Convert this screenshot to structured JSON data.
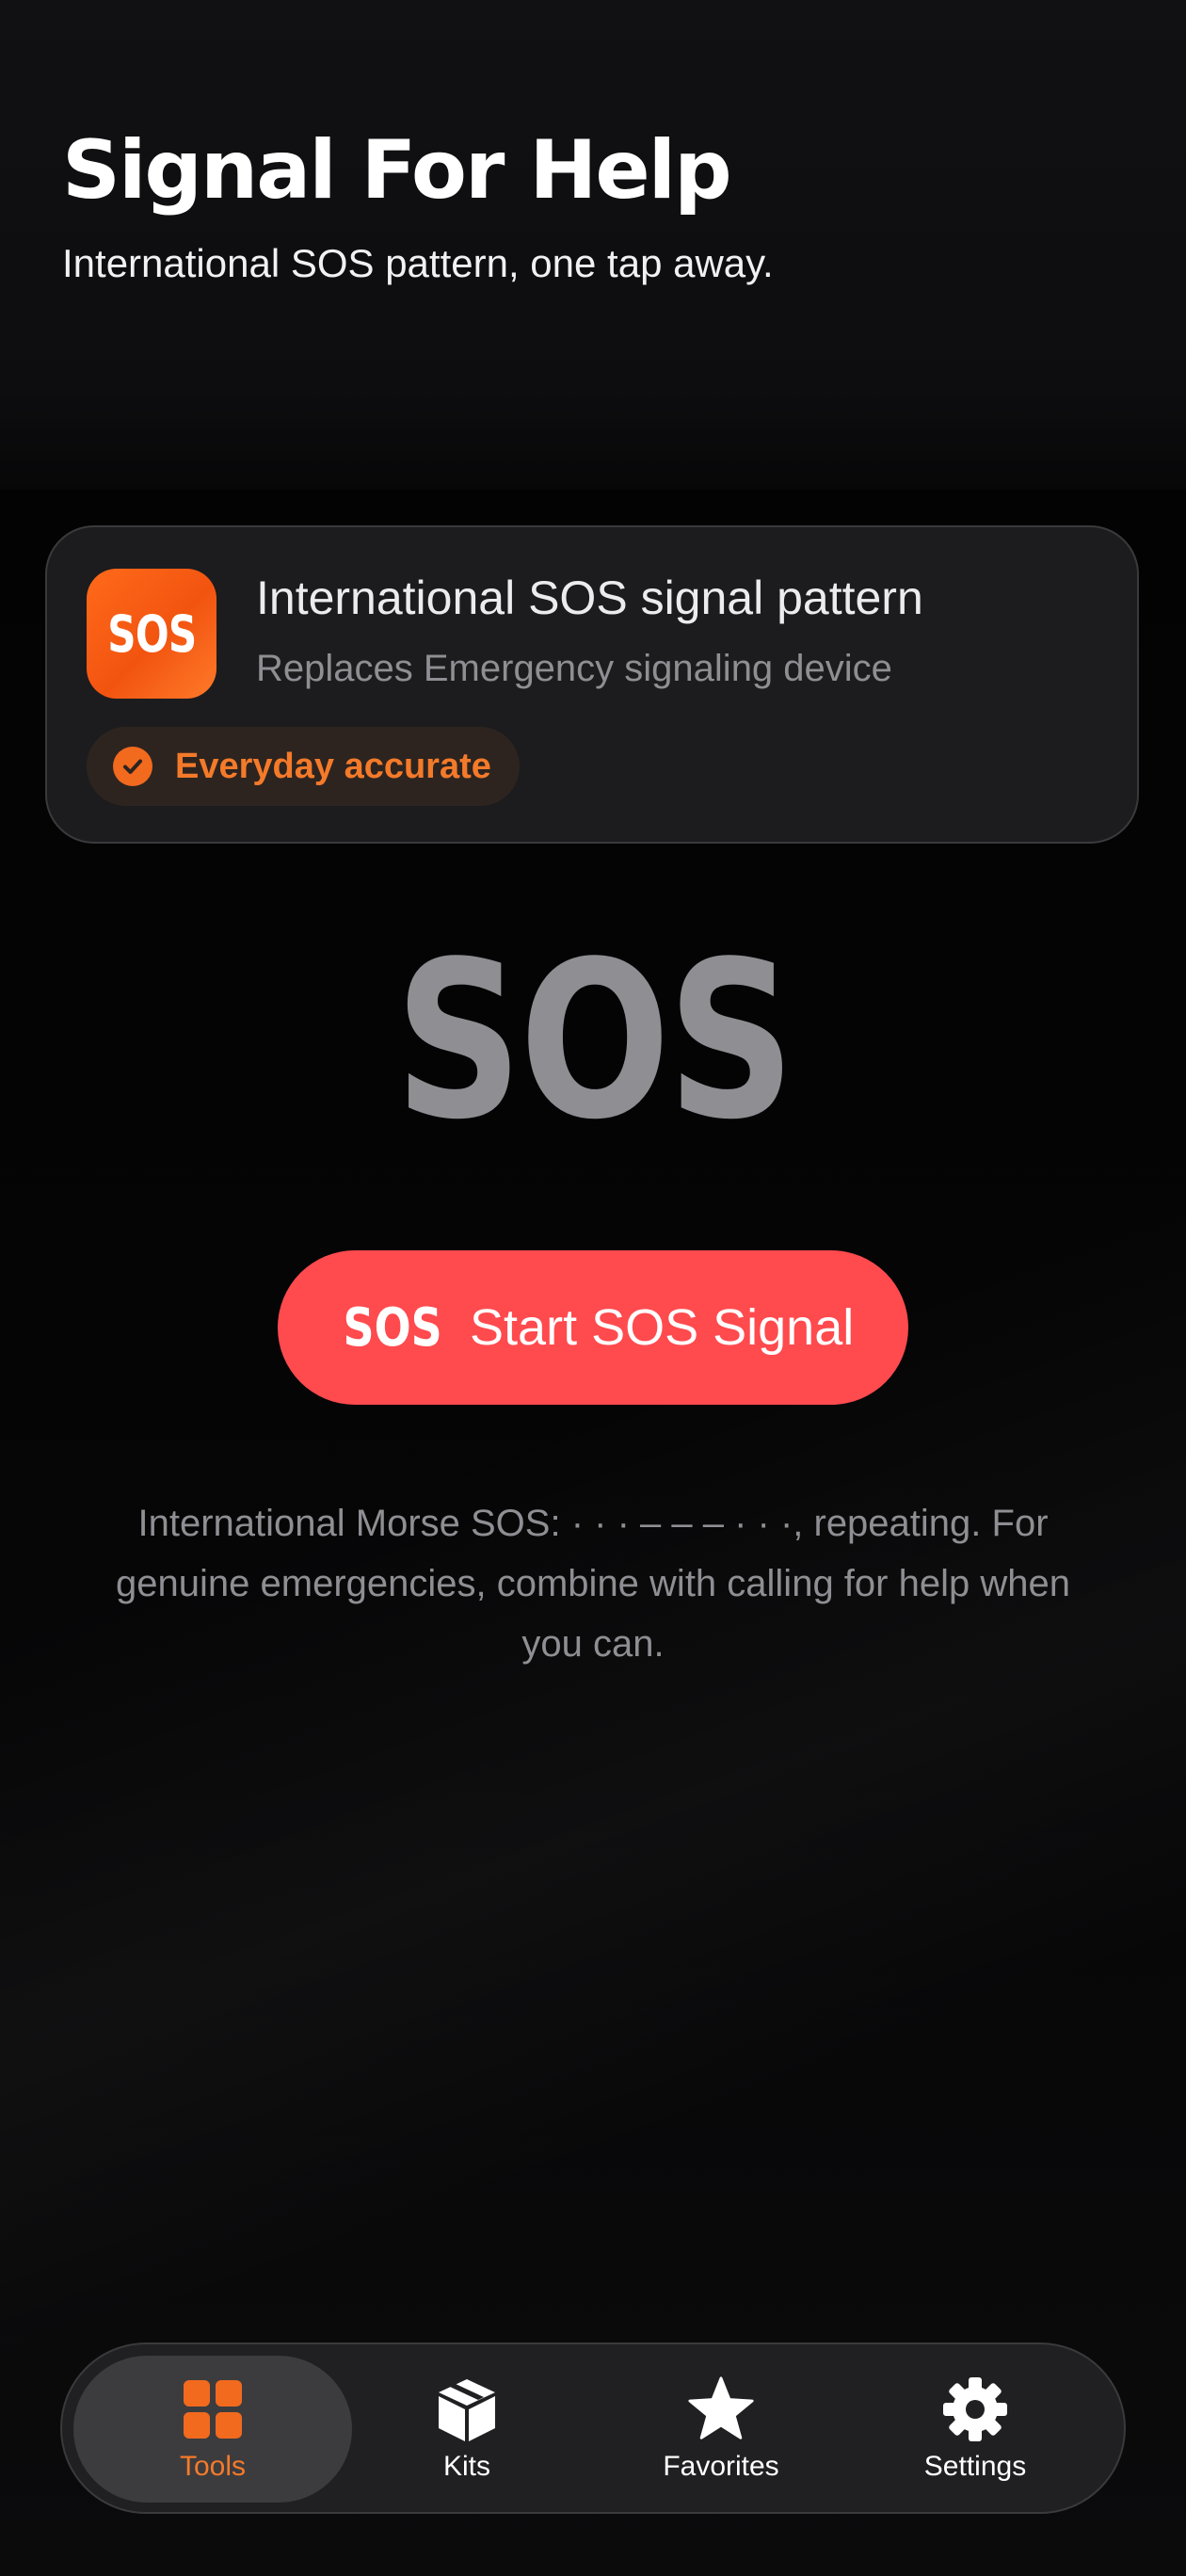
{
  "header": {
    "title": "Signal For Help",
    "subtitle": "International SOS pattern, one tap away."
  },
  "info_card": {
    "icon_text": "SOS",
    "title": "International SOS signal pattern",
    "subtitle": "Replaces Emergency signaling device",
    "badge_label": "Everyday accurate",
    "accent_color": "#F26A1E"
  },
  "display": {
    "sos_text": "SOS"
  },
  "start_button": {
    "icon_text": "SOS",
    "label": "Start SOS Signal",
    "color": "#FF4A4E"
  },
  "description": "International Morse SOS: · · · – – – · · ·, repeating. For genuine emergencies, combine with calling for help when you can.",
  "tab_bar": {
    "tabs": [
      {
        "label": "Tools",
        "icon": "grid-icon",
        "active": true
      },
      {
        "label": "Kits",
        "icon": "box-icon",
        "active": false
      },
      {
        "label": "Favorites",
        "icon": "star-icon",
        "active": false
      },
      {
        "label": "Settings",
        "icon": "gear-icon",
        "active": false
      }
    ]
  }
}
